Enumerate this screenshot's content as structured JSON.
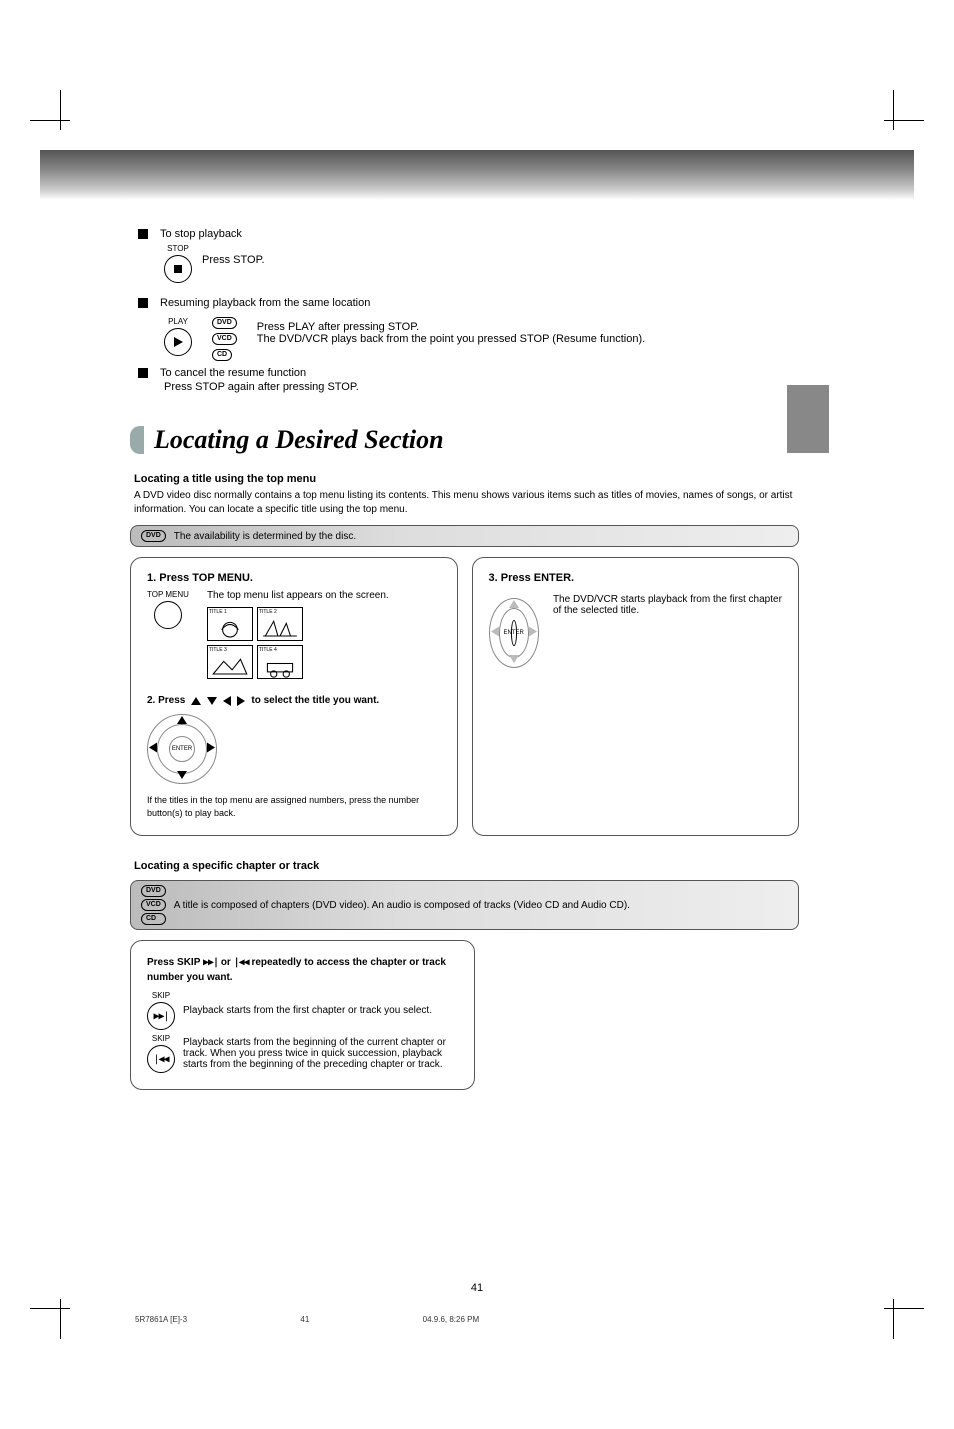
{
  "header": {
    "page_number": "41"
  },
  "footer": {
    "line": "5R7861A [E]-3                                                   41                                                   04.9.6, 8:26 PM"
  },
  "resume": {
    "stop_heading": "To stop playback",
    "stop_label": "STOP",
    "stop_text": "Press STOP.",
    "resume_heading": "Resuming playback from the same location",
    "play_label": "PLAY",
    "play_text": "Press PLAY after pressing STOP.\nThe DVD/VCR plays back from the point you pressed STOP (Resume function).",
    "discs": {
      "dvd": "DVD",
      "vcd": "VCD",
      "cd": "CD"
    },
    "cancel_heading": "To cancel the resume function",
    "cancel_text": "Press STOP again after pressing STOP."
  },
  "section_title": "Locating a Desired Section",
  "menu": {
    "label": "Locating a title using the top menu",
    "desc": "A DVD video disc normally contains a top menu listing its contents. This menu shows various items such as titles of movies, names of songs, or artist information. You can locate a specific title using the top menu.",
    "bar_label": "The availability is determined by the disc.",
    "step1_title": "1. Press TOP MENU.",
    "top_menu_label": "TOP MENU",
    "step1_body": "The top menu list appears on the screen.",
    "thumbs": [
      "TITLE 1",
      "TITLE 2",
      "TITLE 3",
      "TITLE 4"
    ],
    "step2_prefix": "2. Press ",
    "step2_suffix": " to select the title you want.",
    "enter_label": "ENTER",
    "step2_note": "If the titles in the top menu are assigned numbers, press the number button(s) to play back.",
    "step3_title": "3. Press ENTER.",
    "step3_body": "The DVD/VCR starts playback from the first chapter of the selected title."
  },
  "skip": {
    "label": "Locating a specific chapter or track",
    "bar_label": "A title is composed of chapters (DVD video). An audio is composed of tracks (Video CD and Audio CD).",
    "step_pre": "Press SKIP ",
    "step_mid": " or ",
    "step_post": " repeatedly to access the chapter or track number you want.",
    "skip_label": "SKIP",
    "fwd": "Playback starts from the first chapter or track you select.",
    "rev": "Playback starts from the beginning of the current chapter or track. When you press twice in quick succession, playback starts from the beginning of the preceding chapter or track."
  }
}
